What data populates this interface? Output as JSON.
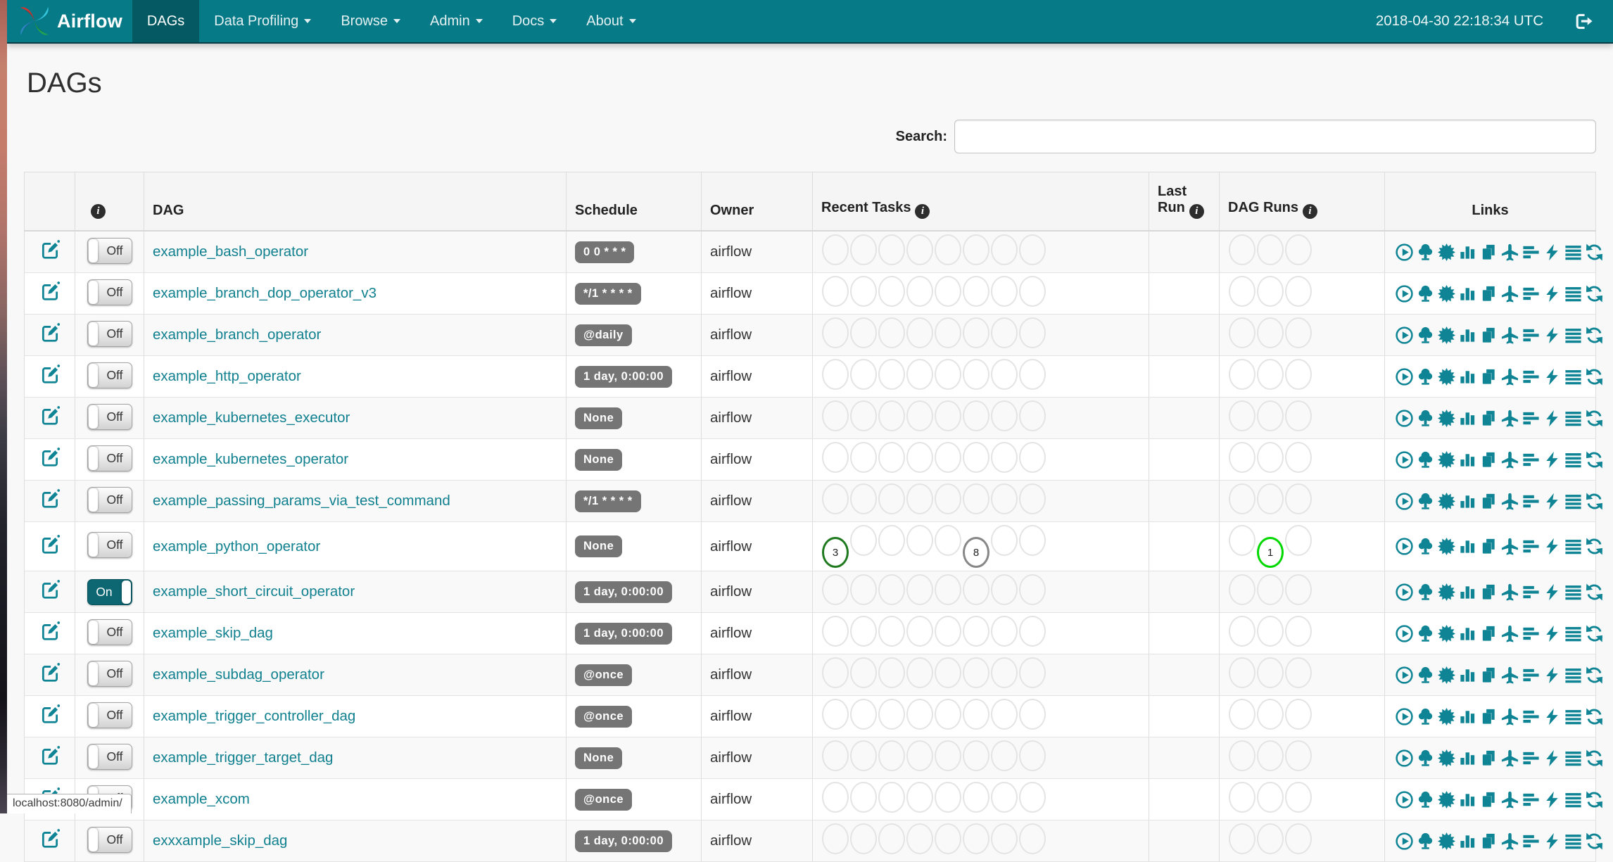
{
  "navbar": {
    "brand": "Airflow",
    "items": [
      {
        "label": "DAGs",
        "active": true,
        "dropdown": false
      },
      {
        "label": "Data Profiling",
        "active": false,
        "dropdown": true
      },
      {
        "label": "Browse",
        "active": false,
        "dropdown": true
      },
      {
        "label": "Admin",
        "active": false,
        "dropdown": true
      },
      {
        "label": "Docs",
        "active": false,
        "dropdown": true
      },
      {
        "label": "About",
        "active": false,
        "dropdown": true
      }
    ],
    "clock": "2018-04-30 22:18:34 UTC"
  },
  "page": {
    "title": "DAGs",
    "search_label": "Search:",
    "search_value": "",
    "url_preview": "localhost:8080/admin/"
  },
  "icons": {
    "info_glyph": "i"
  },
  "colors": {
    "navbar_teal": "#077a87",
    "active_tab_teal": "#055962",
    "link_teal": "#11808f",
    "icon_teal": "#0f8495",
    "badge_gray": "#757575",
    "task_success_green": "#1f7a1f",
    "task_gray": "#878787",
    "run_running_green": "#00d800",
    "circle_empty_border": "#e4e4e4"
  },
  "table": {
    "columns": {
      "dag": "DAG",
      "schedule": "Schedule",
      "owner": "Owner",
      "recent_tasks": "Recent Tasks",
      "last_run": "Last Run",
      "dag_runs": "DAG Runs",
      "links": "Links"
    },
    "recent_task_slots": 8,
    "dag_run_slots": 3,
    "link_icons": [
      "trigger-dag",
      "tree-view",
      "graph-view",
      "task-duration",
      "task-tries",
      "landing-times",
      "gantt-view",
      "code-view",
      "log-view",
      "refresh"
    ],
    "toggle": {
      "on_label": "On",
      "off_label": "Off"
    }
  },
  "dags": [
    {
      "name": "example_bash_operator",
      "schedule": "0 0 * * *",
      "owner": "airflow",
      "enabled": false,
      "recent_tasks": [],
      "dag_runs": [],
      "last_run": ""
    },
    {
      "name": "example_branch_dop_operator_v3",
      "schedule": "*/1 * * * *",
      "owner": "airflow",
      "enabled": false,
      "recent_tasks": [],
      "dag_runs": [],
      "last_run": ""
    },
    {
      "name": "example_branch_operator",
      "schedule": "@daily",
      "owner": "airflow",
      "enabled": false,
      "recent_tasks": [],
      "dag_runs": [],
      "last_run": ""
    },
    {
      "name": "example_http_operator",
      "schedule": "1 day, 0:00:00",
      "owner": "airflow",
      "enabled": false,
      "recent_tasks": [],
      "dag_runs": [],
      "last_run": ""
    },
    {
      "name": "example_kubernetes_executor",
      "schedule": "None",
      "owner": "airflow",
      "enabled": false,
      "recent_tasks": [],
      "dag_runs": [],
      "last_run": ""
    },
    {
      "name": "example_kubernetes_operator",
      "schedule": "None",
      "owner": "airflow",
      "enabled": false,
      "recent_tasks": [],
      "dag_runs": [],
      "last_run": ""
    },
    {
      "name": "example_passing_params_via_test_command",
      "schedule": "*/1 * * * *",
      "owner": "airflow",
      "enabled": false,
      "recent_tasks": [],
      "dag_runs": [],
      "last_run": ""
    },
    {
      "name": "example_python_operator",
      "schedule": "None",
      "owner": "airflow",
      "enabled": false,
      "recent_tasks": [
        {
          "slot": 1,
          "count": "3",
          "color": "#1f7a1f"
        },
        {
          "slot": 6,
          "count": "8",
          "color": "#878787"
        }
      ],
      "dag_runs": [
        {
          "slot": 2,
          "count": "1",
          "color": "#00d800"
        }
      ],
      "last_run": ""
    },
    {
      "name": "example_short_circuit_operator",
      "schedule": "1 day, 0:00:00",
      "owner": "airflow",
      "enabled": true,
      "recent_tasks": [],
      "dag_runs": [],
      "last_run": ""
    },
    {
      "name": "example_skip_dag",
      "schedule": "1 day, 0:00:00",
      "owner": "airflow",
      "enabled": false,
      "recent_tasks": [],
      "dag_runs": [],
      "last_run": ""
    },
    {
      "name": "example_subdag_operator",
      "schedule": "@once",
      "owner": "airflow",
      "enabled": false,
      "recent_tasks": [],
      "dag_runs": [],
      "last_run": ""
    },
    {
      "name": "example_trigger_controller_dag",
      "schedule": "@once",
      "owner": "airflow",
      "enabled": false,
      "recent_tasks": [],
      "dag_runs": [],
      "last_run": ""
    },
    {
      "name": "example_trigger_target_dag",
      "schedule": "None",
      "owner": "airflow",
      "enabled": false,
      "recent_tasks": [],
      "dag_runs": [],
      "last_run": ""
    },
    {
      "name": "example_xcom",
      "schedule": "@once",
      "owner": "airflow",
      "enabled": false,
      "recent_tasks": [],
      "dag_runs": [],
      "last_run": ""
    },
    {
      "name": "exxxample_skip_dag",
      "schedule": "1 day, 0:00:00",
      "owner": "airflow",
      "enabled": false,
      "recent_tasks": [],
      "dag_runs": [],
      "last_run": ""
    }
  ]
}
